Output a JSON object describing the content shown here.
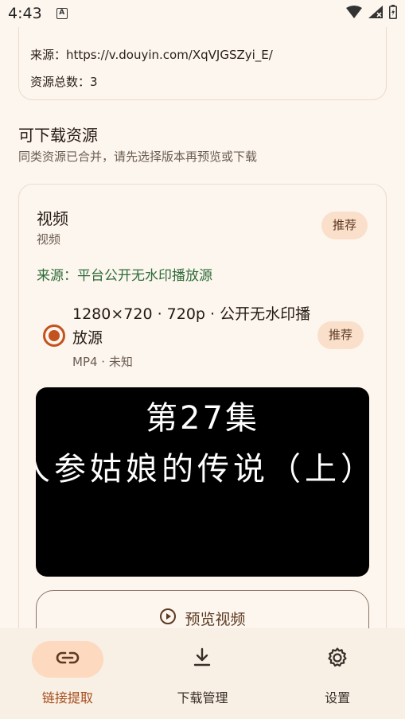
{
  "status_bar": {
    "time": "4:43",
    "notification_icon": "A"
  },
  "info_card": {
    "source": "来源：https://v.douyin.com/XqVJGSZyi_E/",
    "resource_count": "资源总数：3"
  },
  "section": {
    "title": "可下载资源",
    "subtitle": "同类资源已合并，请先选择版本再预览或下载"
  },
  "resource_card": {
    "title": "视频",
    "subtitle": "视频",
    "badge": "推荐",
    "source": "来源：平台公开无水印播放源",
    "option": {
      "title": "1280×720 · 720p · 公开无水印播放源",
      "meta": "MP4 · 未知",
      "badge": "推荐",
      "selected": true
    },
    "thumbnail": {
      "line1": "第27集",
      "line2": "人参姑娘的传说（上）"
    },
    "preview_button": "预览视频"
  },
  "bottom_nav": {
    "items": [
      {
        "label": "链接提取",
        "icon": "link-icon",
        "active": true
      },
      {
        "label": "下载管理",
        "icon": "download-icon",
        "active": false
      },
      {
        "label": "设置",
        "icon": "gear-icon",
        "active": false
      }
    ]
  },
  "colors": {
    "background": "#fdf6ee",
    "accent": "#c4521e",
    "badge_bg": "#fadfca",
    "source_green": "#2e6b3a",
    "nav_active_bg": "#fcd9bf"
  }
}
